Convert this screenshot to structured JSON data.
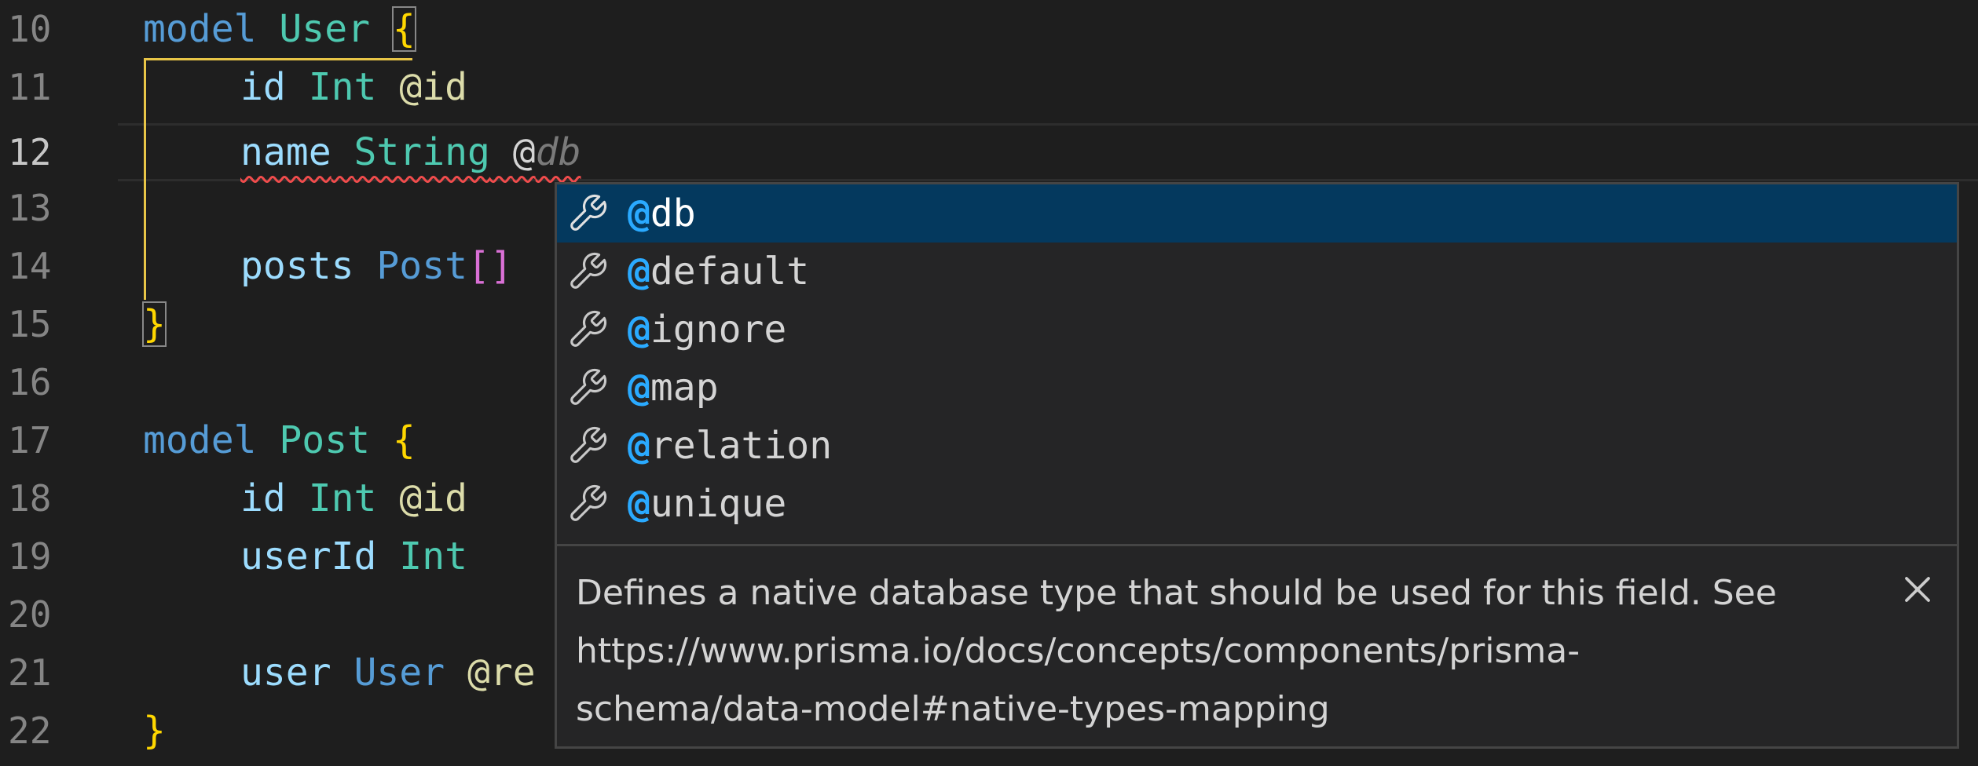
{
  "gutter": {
    "line_numbers": [
      "10",
      "11",
      "12",
      "13",
      "14",
      "15",
      "16",
      "17",
      "18",
      "19",
      "20",
      "21",
      "22"
    ],
    "active_line": "12"
  },
  "code": {
    "l10": {
      "kw": "model",
      "name": "User",
      "brace": "{"
    },
    "l11": {
      "field": "id",
      "type": "Int",
      "attr": "@id"
    },
    "l12": {
      "field": "name",
      "type": "String",
      "at": "@",
      "ghost": "db"
    },
    "l14": {
      "field": "posts",
      "type": "Post",
      "bracket": "[]"
    },
    "l15": {
      "brace": "}"
    },
    "l17": {
      "kw": "model",
      "name": "Post",
      "brace": "{"
    },
    "l18": {
      "field": "id",
      "type": "Int",
      "attr": "@id"
    },
    "l19": {
      "field": "userId",
      "type": "Int"
    },
    "l21": {
      "field": "user",
      "type": "User",
      "attr": "@re"
    },
    "l22": {
      "brace": "}"
    }
  },
  "suggest": {
    "icon": "wrench-icon",
    "items": [
      {
        "prefix": "@",
        "rest": "db"
      },
      {
        "prefix": "@",
        "rest": "default"
      },
      {
        "prefix": "@",
        "rest": "ignore"
      },
      {
        "prefix": "@",
        "rest": "map"
      },
      {
        "prefix": "@",
        "rest": "relation"
      },
      {
        "prefix": "@",
        "rest": "unique"
      }
    ],
    "selected_index": 0,
    "doc_lines": [
      "Defines a native database type that should be used for this field. See",
      "https://www.prisma.io/docs/concepts/components/prisma-",
      "schema/data-model#native-types-mapping"
    ],
    "close_icon": "close-icon"
  },
  "colors": {
    "background": "#1e1e1e",
    "keyword": "#569cd6",
    "type": "#4ec9b0",
    "property": "#9cdcfe",
    "attribute": "#dcdcaa",
    "brace": "#ffd700",
    "selection": "#04395e",
    "match_highlight": "#2aaaff",
    "error_squiggle": "#f14c4c"
  }
}
